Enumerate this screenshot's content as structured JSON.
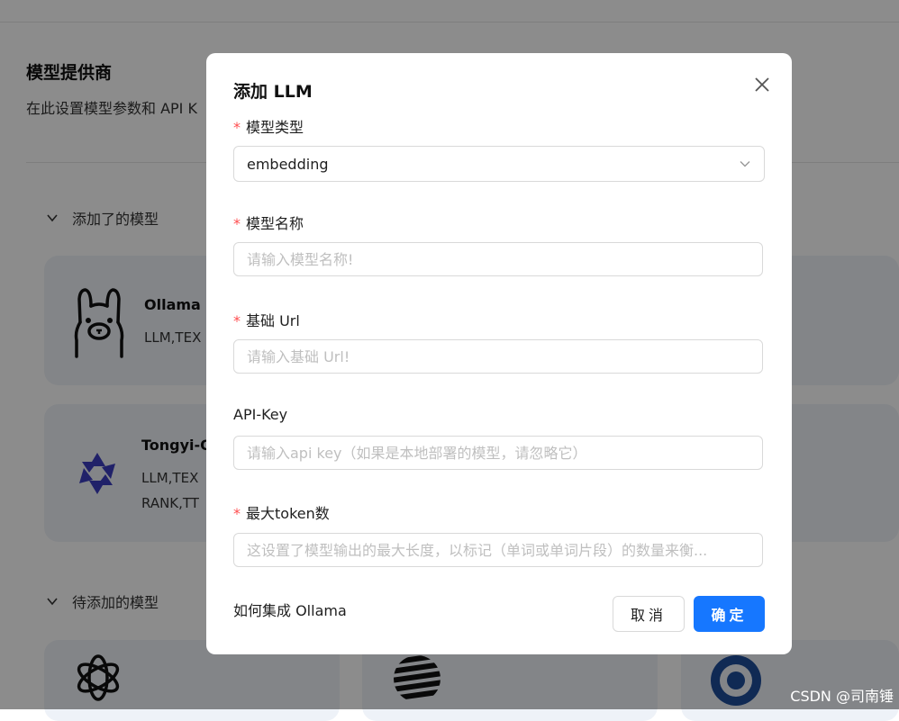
{
  "background": {
    "section_title": "模型提供商",
    "section_desc": "在此设置模型参数和 API K",
    "added_group": "添加了的模型",
    "pending_group": "待添加的模型",
    "cards": [
      {
        "name": "Ollama",
        "tags": "LLM,TEX"
      },
      {
        "name": "Tongyi-Q",
        "tags_line1": "LLM,TEX",
        "tags_line2": "RANK,TT"
      }
    ]
  },
  "modal": {
    "title": "添加 LLM",
    "fields": {
      "model_type": {
        "label": "模型类型",
        "value": "embedding"
      },
      "model_name": {
        "label": "模型名称",
        "placeholder": "请输入模型名称!"
      },
      "base_url": {
        "label": "基础 Url",
        "placeholder": "请输入基础 Url!"
      },
      "api_key": {
        "label": "API-Key",
        "placeholder": "请输入api key（如果是本地部署的模型，请忽略它）"
      },
      "max_tokens": {
        "label": "最大token数",
        "placeholder": "这设置了模型输出的最大长度，以标记（单词或单词片段）的数量来衡..."
      }
    },
    "help_link": "如何集成 Ollama",
    "cancel_label": "取消",
    "ok_label": "确定"
  },
  "watermark": "CSDN @司南锤",
  "colors": {
    "primary": "#1677ff",
    "required": "#ff4d4f",
    "card_bg": "#eef2f8"
  }
}
